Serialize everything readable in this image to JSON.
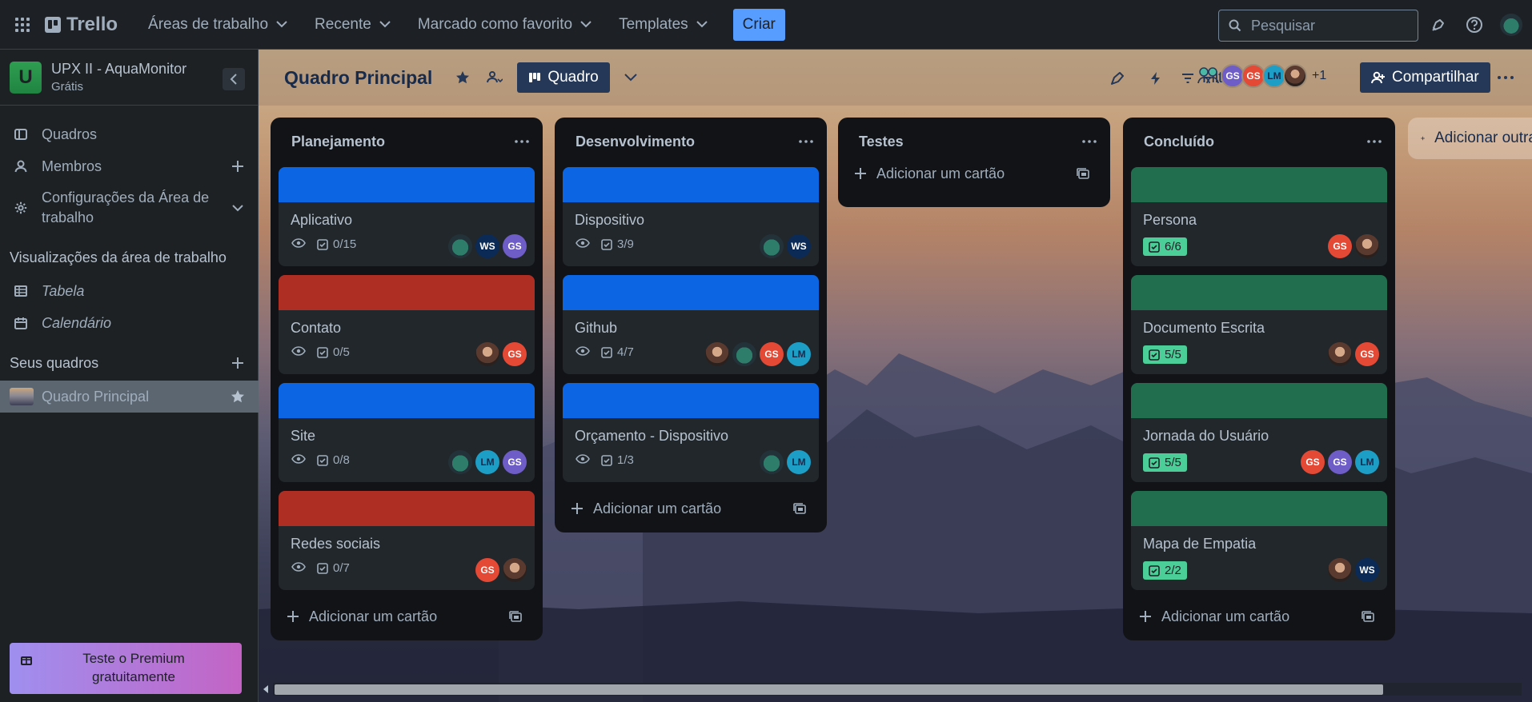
{
  "topbar": {
    "logo_text": "Trello",
    "nav": [
      {
        "label": "Áreas de trabalho"
      },
      {
        "label": "Recente"
      },
      {
        "label": "Marcado como favorito"
      },
      {
        "label": "Templates"
      }
    ],
    "create_label": "Criar",
    "search_placeholder": "Pesquisar"
  },
  "sidebar": {
    "workspace_initial": "U",
    "workspace_name": "UPX II - AquaMonitor",
    "workspace_plan": "Grátis",
    "items": [
      {
        "label": "Quadros"
      },
      {
        "label": "Membros"
      },
      {
        "label": "Configurações da Área de trabalho"
      }
    ],
    "views_heading": "Visualizações da área de trabalho",
    "views": [
      {
        "label": "Tabela"
      },
      {
        "label": "Calendário"
      }
    ],
    "boards_heading": "Seus quadros",
    "boards": [
      {
        "label": "Quadro Principal"
      }
    ],
    "premium_label": "Teste o Premium gratuitamente"
  },
  "board": {
    "title": "Quadro Principal",
    "view_label": "Quadro",
    "filters_label": "Filtros",
    "extra_members": "+1",
    "share_label": "Compartilhar",
    "add_list_label": "Adicionar outra lista"
  },
  "colors": {
    "blue_cover": "#0c66e4",
    "red_cover": "#ae2e24",
    "green_cover": "#216e4e",
    "done_badge": "#4bce97"
  },
  "add_card_label": "Adicionar um cartão",
  "lists": [
    {
      "title": "Planejamento",
      "cards": [
        {
          "title": "Aplicativo",
          "checklist": "0/15",
          "cover": "blue",
          "done": false,
          "members": [
            "frog",
            "WS",
            "GS"
          ]
        },
        {
          "title": "Contato",
          "checklist": "0/5",
          "cover": "red",
          "done": false,
          "members": [
            "photo",
            "GS2"
          ]
        },
        {
          "title": "Site",
          "checklist": "0/8",
          "cover": "blue",
          "done": false,
          "members": [
            "frog",
            "LM",
            "GS"
          ]
        },
        {
          "title": "Redes sociais",
          "checklist": "0/7",
          "cover": "red",
          "done": false,
          "members": [
            "GS2",
            "photo"
          ]
        }
      ]
    },
    {
      "title": "Desenvolvimento",
      "cards": [
        {
          "title": "Dispositivo",
          "checklist": "3/9",
          "cover": "blue",
          "done": false,
          "members": [
            "frog",
            "WS"
          ]
        },
        {
          "title": "Github",
          "checklist": "4/7",
          "cover": "blue",
          "done": false,
          "members": [
            "photo",
            "frog",
            "GS2",
            "LM"
          ]
        },
        {
          "title": "Orçamento - Dispositivo",
          "checklist": "1/3",
          "cover": "blue",
          "done": false,
          "members": [
            "frog",
            "LM"
          ]
        }
      ]
    },
    {
      "title": "Testes",
      "cards": []
    },
    {
      "title": "Concluído",
      "cards": [
        {
          "title": "Persona",
          "checklist": "6/6",
          "cover": "green",
          "done": true,
          "members": [
            "GS2",
            "photo"
          ]
        },
        {
          "title": "Documento Escrita",
          "checklist": "5/5",
          "cover": "green",
          "done": true,
          "members": [
            "photo",
            "GS2"
          ]
        },
        {
          "title": "Jornada do Usuário",
          "checklist": "5/5",
          "cover": "green",
          "done": true,
          "members": [
            "GS2",
            "GS",
            "LM"
          ]
        },
        {
          "title": "Mapa de Empatia",
          "checklist": "2/2",
          "cover": "green",
          "done": true,
          "members": [
            "photo",
            "WS"
          ]
        }
      ]
    }
  ],
  "header_members": [
    "team",
    "GS",
    "GS2",
    "LM",
    "photo"
  ]
}
